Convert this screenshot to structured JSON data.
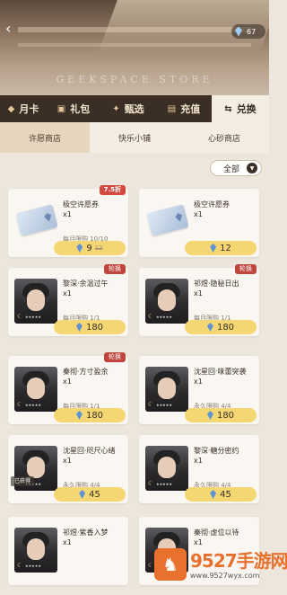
{
  "header": {
    "store_title": "GEEKSPACE STORE",
    "currency_amount": "67"
  },
  "tabs": [
    {
      "label": "月卡",
      "icon": "◆"
    },
    {
      "label": "礼包",
      "icon": "▣"
    },
    {
      "label": "甄选",
      "icon": "✦"
    },
    {
      "label": "充值",
      "icon": "▤"
    },
    {
      "label": "兑换",
      "icon": "⇆"
    }
  ],
  "subtabs": [
    {
      "label": "许愿商店"
    },
    {
      "label": "快乐小铺"
    },
    {
      "label": "心砂商店"
    }
  ],
  "filter": {
    "label": "全部"
  },
  "items": [
    {
      "name": "极空许愿券",
      "qty": "x1",
      "limit": "每月限购 10/10",
      "price": "9",
      "old_price": "12",
      "badge": "7.5折",
      "type": "ticket"
    },
    {
      "name": "极空许愿券",
      "qty": "x1",
      "limit": "",
      "price": "12",
      "badge": "",
      "type": "ticket"
    },
    {
      "name": "黎深·余温过午",
      "qty": "x1",
      "limit": "每月限购 1/1",
      "price": "180",
      "badge": "轮换",
      "type": "portrait"
    },
    {
      "name": "祁煜·隐秘日出",
      "qty": "x1",
      "limit": "每月限购 1/1",
      "price": "180",
      "badge": "轮换",
      "type": "portrait"
    },
    {
      "name": "秦彻·方寸盈余",
      "qty": "x1",
      "limit": "每月限购 1/1",
      "price": "180",
      "badge": "轮换",
      "type": "portrait"
    },
    {
      "name": "沈星回·味蕾突袭",
      "qty": "x1",
      "limit": "永久限购 4/4",
      "price": "180",
      "badge": "",
      "type": "portrait"
    },
    {
      "name": "沈星回·咫尺心绪",
      "qty": "x1",
      "limit": "永久限购 4/4",
      "price": "45",
      "badge": "",
      "owned": "已获得",
      "type": "portrait"
    },
    {
      "name": "黎深·糖分密约",
      "qty": "x1",
      "limit": "永久限购 4/4",
      "price": "45",
      "badge": "",
      "type": "portrait"
    },
    {
      "name": "祁煜·紫香入梦",
      "qty": "x1",
      "limit": "",
      "price": "",
      "badge": "",
      "type": "portrait"
    },
    {
      "name": "秦彻·虚位以待",
      "qty": "x1",
      "limit": "",
      "price": "",
      "badge": "",
      "type": "portrait"
    }
  ],
  "watermark": {
    "logo_char": "♞",
    "title": "9527手游网",
    "url": "www.9527wyx.com"
  }
}
